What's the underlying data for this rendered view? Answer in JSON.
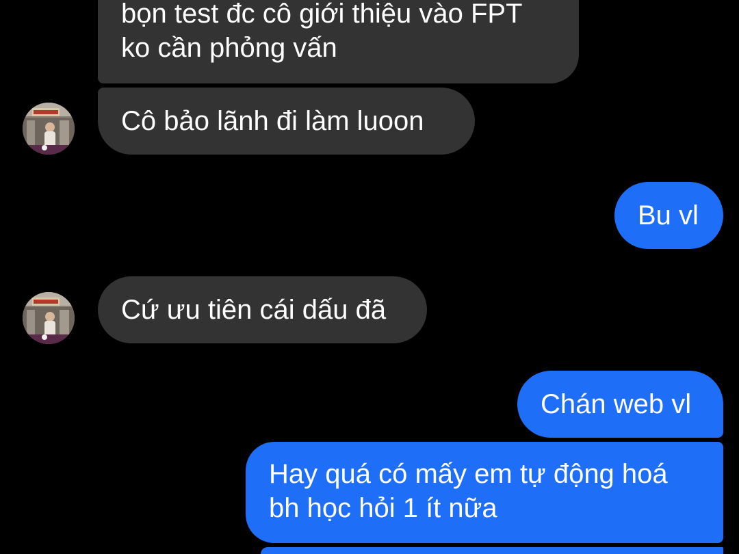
{
  "colors": {
    "background": "#000000",
    "incoming_bubble": "#333333",
    "outgoing_bubble": "#1f6ef7",
    "text": "#ffffff"
  },
  "messages": [
    {
      "direction": "incoming",
      "lines": [
        "bọn test đc cô giới thiệu vào FPT",
        "ko cần phỏng vấn"
      ],
      "avatar": false
    },
    {
      "direction": "incoming",
      "lines": [
        "Cô bảo lãnh đi làm luoon"
      ],
      "avatar": "contact-avatar-icon"
    },
    {
      "direction": "outgoing",
      "lines": [
        "Bu vl"
      ]
    },
    {
      "direction": "incoming",
      "lines": [
        "Cứ ưu tiên cái dấu đã"
      ],
      "avatar": "contact-avatar-icon"
    },
    {
      "direction": "outgoing",
      "lines": [
        "Chán web vl"
      ]
    },
    {
      "direction": "outgoing",
      "lines": [
        "Hay quá có mấy em tự động hoá",
        "bh học hỏi 1 ít nữa"
      ]
    },
    {
      "direction": "outgoing",
      "lines": [],
      "partial": true
    }
  ]
}
